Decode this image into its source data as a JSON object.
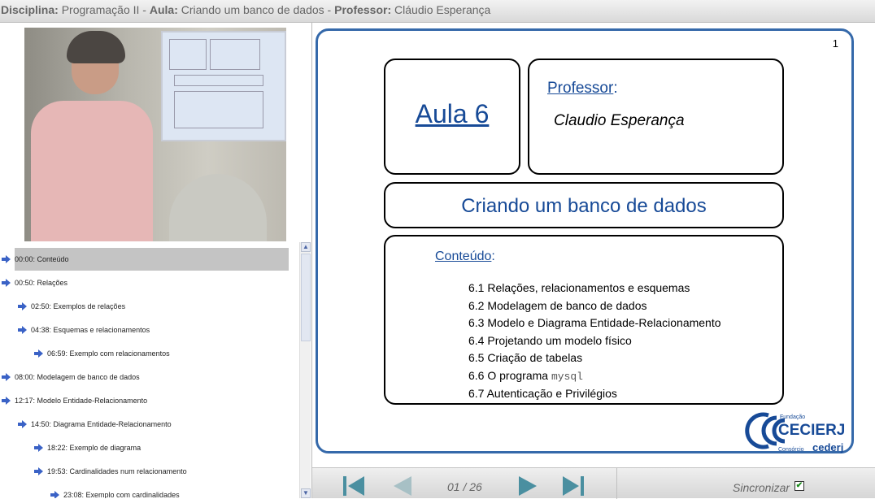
{
  "header": {
    "disciplina_label": "Disciplina:",
    "disciplina": "Programação II",
    "sep1": " - ",
    "aula_label": "Aula:",
    "aula": "Criando um banco de dados",
    "sep2": " - ",
    "professor_label": "Professor:",
    "professor": "Cláudio Esperança"
  },
  "toc": [
    {
      "text": "00:00: Conteúdo",
      "level": 0,
      "selected": true
    },
    {
      "text": "00:50: Relações",
      "level": 0
    },
    {
      "text": "02:50: Exemplos de relações",
      "level": 1
    },
    {
      "text": "04:38: Esquemas e relacionamentos",
      "level": 1
    },
    {
      "text": "06:59: Exemplo com relacionamentos",
      "level": 2
    },
    {
      "text": "08:00: Modelagem de banco de dados",
      "level": 0
    },
    {
      "text": "12:17: Modelo Entidade-Relacionamento",
      "level": 0
    },
    {
      "text": "14:50: Diagrama Entidade-Relacionamento",
      "level": 1
    },
    {
      "text": "18:22: Exemplo de diagrama",
      "level": 2
    },
    {
      "text": "19:53: Cardinalidades num relacionamento",
      "level": 2
    },
    {
      "text": "23:08: Exemplo com cardinalidades",
      "level": 3
    }
  ],
  "slide": {
    "number": "1",
    "aula": "Aula 6",
    "professor_label": "Professor",
    "colon": ":",
    "professor_name": "Claudio Esperança",
    "title": "Criando um banco de dados",
    "conteudo_label": "Conteúdo",
    "items": [
      "6.1 Relações, relacionamentos e esquemas",
      "6.2 Modelagem de banco de dados",
      "6.3 Modelo e Diagrama Entidade-Relacionamento",
      "6.4 Projetando um modelo físico",
      "6.5 Criação de tabelas"
    ],
    "item6_prefix": "6.6 O programa ",
    "item6_mono": "mysql",
    "item7": "6.7 Autenticação e Privilégios",
    "logo": {
      "fundacao": "Fundação",
      "cecierj": "CECIERJ",
      "consorcio": "Consórcio",
      "cederj": "cederj"
    }
  },
  "player": {
    "counter": "01 / 26",
    "sync_label": "Sincronizar",
    "sync_checked": true
  },
  "colors": {
    "accent": "#174a97",
    "slide_border": "#3569aa",
    "arrow": "#3a62c6"
  }
}
